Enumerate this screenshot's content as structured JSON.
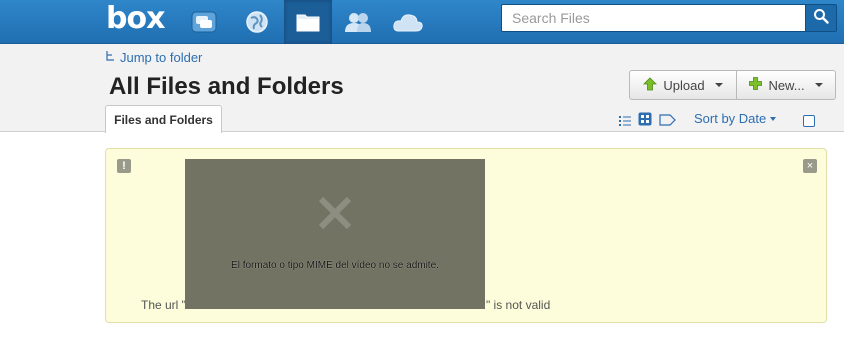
{
  "brand": {
    "logo": "box"
  },
  "topnav": {
    "items": [
      {
        "name": "updates",
        "icon": "chat-bubbles-icon",
        "active": false
      },
      {
        "name": "web",
        "icon": "globe-icon",
        "active": false
      },
      {
        "name": "files",
        "icon": "folder-icon",
        "active": true
      },
      {
        "name": "people",
        "icon": "people-icon",
        "active": false
      },
      {
        "name": "sync",
        "icon": "cloud-icon",
        "active": false
      }
    ]
  },
  "search": {
    "placeholder": "Search Files",
    "value": ""
  },
  "header": {
    "jump_label": "Jump to folder",
    "title": "All Files and Folders",
    "upload_label": "Upload",
    "new_label": "New...",
    "tab_label": "Files and Folders",
    "sort_label": "Sort by Date"
  },
  "alert": {
    "icon": "!",
    "close": "×",
    "message_prefix": "The url \"",
    "message_suffix": "\" is not valid"
  },
  "video": {
    "error_text": "El formato o tipo MIME del vídeo no se admite."
  },
  "colors": {
    "topbar": "#2f86c9",
    "accent_link": "#2c6eb0",
    "alert_bg": "#fdfddb",
    "video_bg": "#737364"
  }
}
